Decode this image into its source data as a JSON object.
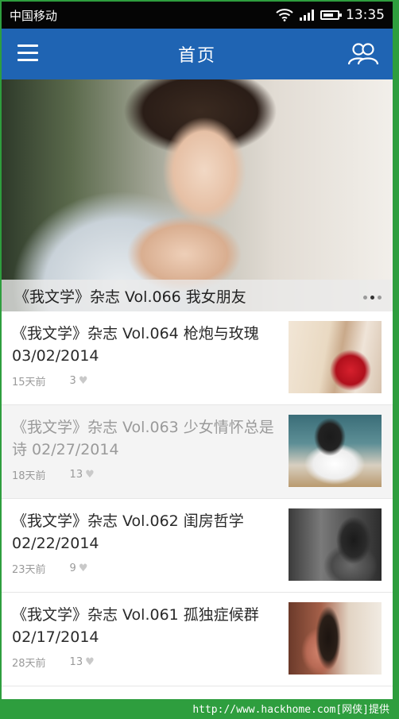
{
  "status_bar": {
    "carrier": "中国移动",
    "time": "13:35",
    "battery_level": 0.75
  },
  "header": {
    "title": "首页",
    "menu_icon": "hamburger-menu-icon",
    "people_icon": "people-group-icon",
    "bar_color": "#1f64b3"
  },
  "hero": {
    "caption": "《我文学》杂志 Vol.066 我女朋友",
    "pager": {
      "count": 3,
      "active_index": 1
    }
  },
  "articles": [
    {
      "title": "《我文学》杂志 Vol.064 枪炮与玫瑰 03/02/2014",
      "age": "15天前",
      "likes": "3"
    },
    {
      "title": "《我文学》杂志 Vol.063 少女情怀总是诗 02/27/2014",
      "age": "18天前",
      "likes": "13"
    },
    {
      "title": "《我文学》杂志 Vol.062 闺房哲学 02/22/2014",
      "age": "23天前",
      "likes": "9"
    },
    {
      "title": "《我文学》杂志 Vol.061 孤独症候群 02/17/2014",
      "age": "28天前",
      "likes": "13"
    }
  ],
  "watermark": "http://www.hackhome.com[网侠]提供",
  "colors": {
    "frame": "#2e9e3e",
    "accent": "#1f64b3"
  }
}
